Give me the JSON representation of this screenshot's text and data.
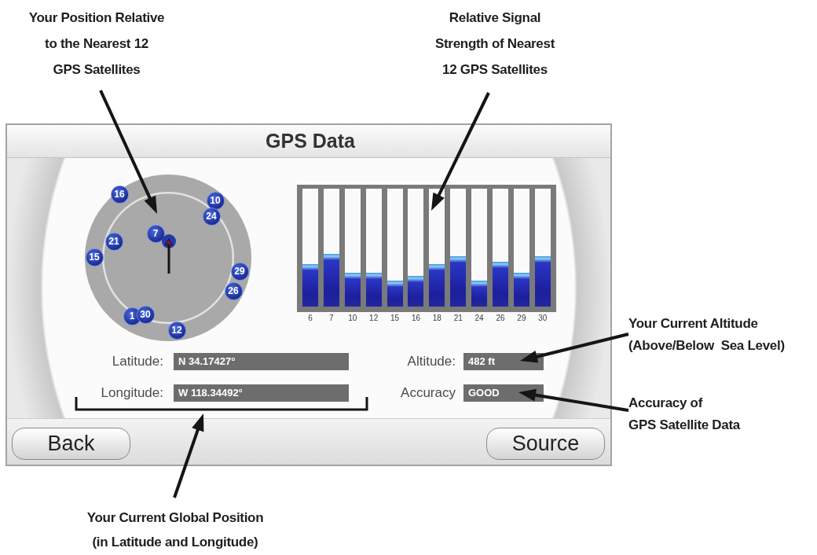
{
  "callouts": [
    {
      "text": "Your Position Relative\nto the Nearest 12\nGPS Satellites"
    },
    {
      "text": "Relative Signal\nStrength of Nearest\n12 GPS Satellites"
    },
    {
      "text": "Your Current Altitude\n(Above/Below  Sea Level)"
    },
    {
      "text": "Accuracy of\nGPS Satellite Data"
    },
    {
      "text": "Your Current Global Position\n(in Latitude and Longitude)"
    }
  ],
  "gps_screen": {
    "title": "GPS Data",
    "sky_plot": {
      "satellites": [
        {
          "kind": "numbered",
          "label": "16"
        },
        {
          "kind": "numbered",
          "label": "10"
        },
        {
          "kind": "numbered",
          "label": "24"
        },
        {
          "kind": "numbered",
          "label": "7"
        },
        {
          "kind": "covered"
        },
        {
          "kind": "numbered",
          "label": "21"
        },
        {
          "kind": "numbered",
          "label": "15"
        },
        {
          "kind": "numbered",
          "label": "29"
        },
        {
          "kind": "numbered",
          "label": "26"
        },
        {
          "kind": "numbered",
          "label": "1"
        },
        {
          "kind": "numbered",
          "label": "30"
        },
        {
          "kind": "numbered",
          "label": "12"
        }
      ]
    },
    "signal_strength": {
      "bars": [
        {
          "label": "6",
          "level": 0.36
        },
        {
          "label": "7",
          "level": 0.45
        },
        {
          "label": "10",
          "level": 0.29
        },
        {
          "label": "12",
          "level": 0.29
        },
        {
          "label": "15",
          "level": 0.22
        },
        {
          "label": "16",
          "level": 0.26
        },
        {
          "label": "18",
          "level": 0.36
        },
        {
          "label": "21",
          "level": 0.43
        },
        {
          "label": "24",
          "level": 0.22
        },
        {
          "label": "26",
          "level": 0.38
        },
        {
          "label": "29",
          "level": 0.29
        },
        {
          "label": "30",
          "level": 0.43
        }
      ]
    },
    "fields": [
      {
        "label": "Latitude:",
        "value": "N 34.17427°"
      },
      {
        "label": "Altitude:",
        "value": "482 ft"
      },
      {
        "label": "Longitude:",
        "value": "W 118.34492°"
      },
      {
        "label": "Accuracy",
        "value": "GOOD"
      }
    ],
    "buttons": [
      "Back",
      "Source"
    ]
  }
}
